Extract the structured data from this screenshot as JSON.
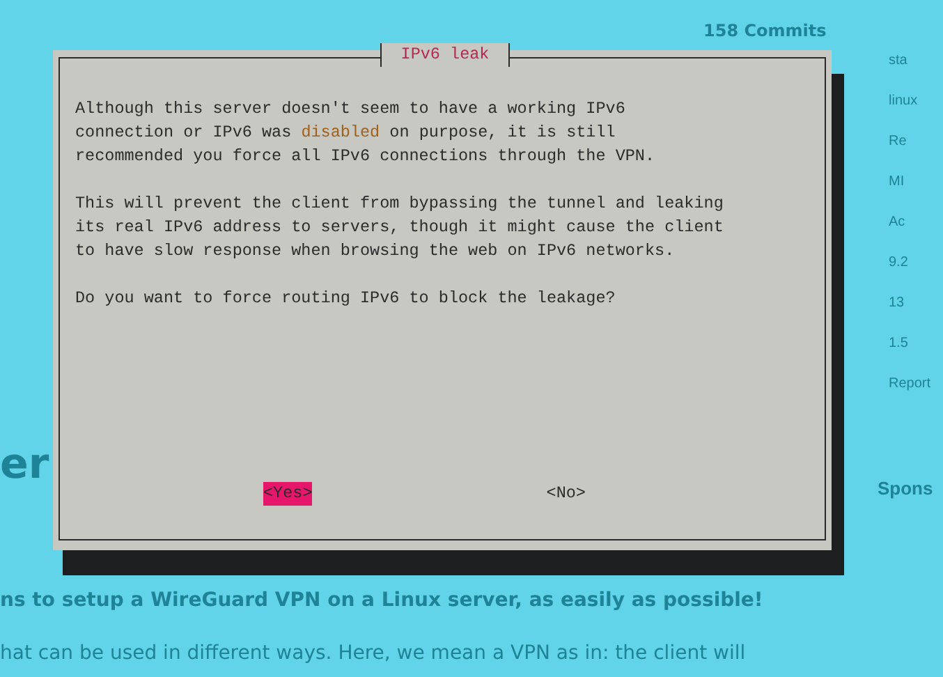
{
  "page": {
    "commits": "158 Commits",
    "heading": "er",
    "lines": [
      "ns to setup a WireGuard VPN on a Linux server, as easily as possible!",
      "hat can be used in different ways. Here, we mean a VPN as in: the client will"
    ],
    "sidebar": [
      "sta",
      "linux",
      "Re",
      "MI",
      "Ac",
      "9.2",
      "13",
      "1.5",
      "Report"
    ],
    "sponsors_heading": "Spons"
  },
  "dialog": {
    "title": "IPv6 leak",
    "paragraphs": [
      [
        {
          "text": "Although this server doesn't seem to have a working IPv6\nconnection or IPv6 was ",
          "highlight": false
        },
        {
          "text": "disabled",
          "highlight": true
        },
        {
          "text": " on purpose, it is still\nrecommended you force all IPv6 connections through the VPN.",
          "highlight": false
        }
      ],
      [
        {
          "text": "This will prevent the client from bypassing the tunnel and leaking\nits real IPv6 address to servers, though it might cause the client\nto have slow response when browsing the web on IPv6 networks.",
          "highlight": false
        }
      ],
      [
        {
          "text": "Do you want to force routing IPv6 to block the leakage?",
          "highlight": false
        }
      ]
    ],
    "buttons": [
      {
        "label": "<Yes>",
        "selected": true
      },
      {
        "label": "<No>",
        "selected": false
      }
    ]
  }
}
